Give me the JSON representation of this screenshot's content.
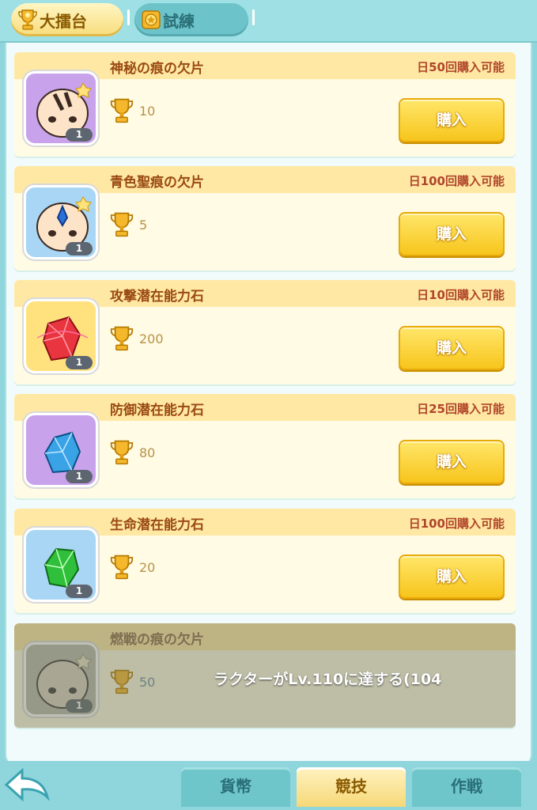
{
  "top_tabs": [
    {
      "label": "大擂台",
      "active": true
    },
    {
      "label": "試練",
      "active": false
    }
  ],
  "items": [
    {
      "name": "神秘の痕の欠片",
      "limit": "日50回購入可能",
      "cost": "10",
      "qty": "1",
      "buy_label": "購入",
      "thumb_color": "purple",
      "icon": "bald-head-mark-icon"
    },
    {
      "name": "青色聖痕の欠片",
      "limit": "日100回購入可能",
      "cost": "5",
      "qty": "1",
      "buy_label": "購入",
      "thumb_color": "blue",
      "icon": "bald-head-blue-mark-icon"
    },
    {
      "name": "攻撃潜在能力石",
      "limit": "日10回購入可能",
      "cost": "200",
      "qty": "1",
      "buy_label": "購入",
      "thumb_color": "gold",
      "icon": "red-crystal-icon"
    },
    {
      "name": "防御潜在能力石",
      "limit": "日25回購入可能",
      "cost": "80",
      "qty": "1",
      "buy_label": "購入",
      "thumb_color": "purple",
      "icon": "blue-crystal-icon"
    },
    {
      "name": "生命潜在能力石",
      "limit": "日100回購入可能",
      "cost": "20",
      "qty": "1",
      "buy_label": "購入",
      "thumb_color": "blue",
      "icon": "green-crystal-icon"
    },
    {
      "name": "燃戦の痕の欠片",
      "locked_message": "ラクターがLv.110に達する(104",
      "cost": "50",
      "qty": "1",
      "thumb_color": "grey",
      "icon": "bald-head-icon"
    }
  ],
  "bottom_tabs": [
    {
      "label": "貨幣",
      "active": false
    },
    {
      "label": "競技",
      "active": true
    },
    {
      "label": "作戦",
      "active": false
    }
  ],
  "colors": {
    "accent": "#f7c51c",
    "panel": "#f2fbfc",
    "header": "#ffe8a4",
    "background": "#8fd6dc"
  }
}
